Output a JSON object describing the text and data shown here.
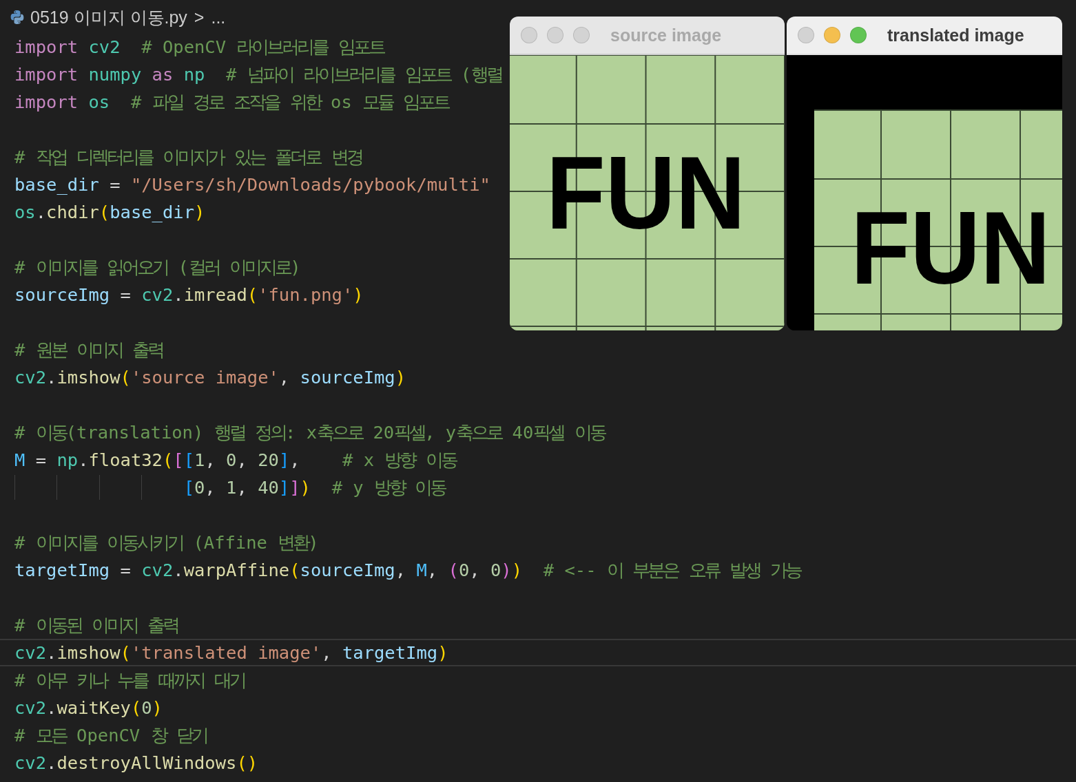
{
  "breadcrumb": {
    "file": "0519 이미지 이동.py",
    "separator": ">",
    "more": "..."
  },
  "code_lines": [
    {
      "current": false,
      "tokens": [
        {
          "text": "import",
          "kind": "kw"
        },
        {
          "text": " cv2",
          "kind": "mod"
        },
        {
          "text": "  # OpenCV 라이브러리를 임포트",
          "kind": "cm"
        }
      ]
    },
    {
      "current": false,
      "tokens": [
        {
          "text": "import",
          "kind": "kw"
        },
        {
          "text": " numpy",
          "kind": "mod"
        },
        {
          "text": " as",
          "kind": "kw"
        },
        {
          "text": " np",
          "kind": "mod"
        },
        {
          "text": "  # 넘파이 라이브러리를 임포트 (행렬",
          "kind": "cm"
        }
      ]
    },
    {
      "current": false,
      "tokens": [
        {
          "text": "import",
          "kind": "kw"
        },
        {
          "text": " os",
          "kind": "mod"
        },
        {
          "text": "  # 파일 경로 조작을 위한 os 모듈 임포트",
          "kind": "cm"
        }
      ]
    },
    {
      "current": false
    },
    {
      "current": false,
      "tokens": [
        {
          "text": "# 작업 디렉터리를 이미지가 있는 폴더로 변경",
          "kind": "cm"
        }
      ]
    },
    {
      "current": false,
      "tokens": [
        {
          "text": "base_dir",
          "kind": "var"
        },
        {
          "text": " = ",
          "kind": "p"
        },
        {
          "text": "\"/Users/sh/Downloads/pybook/multi\"",
          "kind": "str"
        }
      ]
    },
    {
      "current": false,
      "tokens": [
        {
          "text": "os",
          "kind": "mod"
        },
        {
          "text": ".",
          "kind": "p"
        },
        {
          "text": "chdir",
          "kind": "fn"
        },
        {
          "text": "(",
          "kind": "b1"
        },
        {
          "text": "base_dir",
          "kind": "var"
        },
        {
          "text": ")",
          "kind": "b1"
        }
      ]
    },
    {
      "current": false
    },
    {
      "current": false,
      "tokens": [
        {
          "text": "# 이미지를 읽어오기 (컬러 이미지로)",
          "kind": "cm"
        }
      ]
    },
    {
      "current": false,
      "tokens": [
        {
          "text": "sourceImg",
          "kind": "var"
        },
        {
          "text": " = ",
          "kind": "p"
        },
        {
          "text": "cv2",
          "kind": "mod"
        },
        {
          "text": ".",
          "kind": "p"
        },
        {
          "text": "imread",
          "kind": "fn"
        },
        {
          "text": "(",
          "kind": "b1"
        },
        {
          "text": "'fun.png'",
          "kind": "str"
        },
        {
          "text": ")",
          "kind": "b1"
        }
      ]
    },
    {
      "current": false
    },
    {
      "current": false,
      "tokens": [
        {
          "text": "# 원본 이미지 출력",
          "kind": "cm"
        }
      ]
    },
    {
      "current": false,
      "tokens": [
        {
          "text": "cv2",
          "kind": "mod"
        },
        {
          "text": ".",
          "kind": "p"
        },
        {
          "text": "imshow",
          "kind": "fn"
        },
        {
          "text": "(",
          "kind": "b1"
        },
        {
          "text": "'source image'",
          "kind": "str"
        },
        {
          "text": ",",
          "kind": "p"
        },
        {
          "text": " sourceImg",
          "kind": "var"
        },
        {
          "text": ")",
          "kind": "b1"
        }
      ]
    },
    {
      "current": false
    },
    {
      "current": false,
      "tokens": [
        {
          "text": "# 이동(translation) 행렬 정의: x축으로 20픽셀, y축으로 40픽셀 이동",
          "kind": "cm"
        }
      ]
    },
    {
      "current": false,
      "tokens": [
        {
          "text": "M",
          "kind": "const"
        },
        {
          "text": " = ",
          "kind": "p"
        },
        {
          "text": "np",
          "kind": "mod"
        },
        {
          "text": ".",
          "kind": "p"
        },
        {
          "text": "float32",
          "kind": "fn"
        },
        {
          "text": "(",
          "kind": "b1"
        },
        {
          "text": "[",
          "kind": "b2"
        },
        {
          "text": "[",
          "kind": "b3"
        },
        {
          "text": "1",
          "kind": "num"
        },
        {
          "text": ",",
          "kind": "p"
        },
        {
          "text": " 0",
          "kind": "num"
        },
        {
          "text": ",",
          "kind": "p"
        },
        {
          "text": " 20",
          "kind": "num"
        },
        {
          "text": "]",
          "kind": "b3"
        },
        {
          "text": ",",
          "kind": "p"
        },
        {
          "text": "    # x 방향 이동",
          "kind": "cm"
        }
      ]
    },
    {
      "current": false,
      "tokens": [
        {
          "text": "                [",
          "kind": "b3"
        },
        {
          "text": "0",
          "kind": "num"
        },
        {
          "text": ",",
          "kind": "p"
        },
        {
          "text": " 1",
          "kind": "num"
        },
        {
          "text": ",",
          "kind": "p"
        },
        {
          "text": " 40",
          "kind": "num"
        },
        {
          "text": "]",
          "kind": "b3"
        },
        {
          "text": "]",
          "kind": "b2"
        },
        {
          "text": ")",
          "kind": "b1"
        },
        {
          "text": "  # y 방향 이동",
          "kind": "cm"
        }
      ]
    },
    {
      "current": false
    },
    {
      "current": false,
      "tokens": [
        {
          "text": "# 이미지를 이동시키기 (Affine 변환)",
          "kind": "cm"
        }
      ]
    },
    {
      "current": false,
      "tokens": [
        {
          "text": "targetImg",
          "kind": "var"
        },
        {
          "text": " = ",
          "kind": "p"
        },
        {
          "text": "cv2",
          "kind": "mod"
        },
        {
          "text": ".",
          "kind": "p"
        },
        {
          "text": "warpAffine",
          "kind": "fn"
        },
        {
          "text": "(",
          "kind": "b1"
        },
        {
          "text": "sourceImg",
          "kind": "var"
        },
        {
          "text": ",",
          "kind": "p"
        },
        {
          "text": " M",
          "kind": "const"
        },
        {
          "text": ",",
          "kind": "p"
        },
        {
          "text": " (",
          "kind": "b2"
        },
        {
          "text": "0",
          "kind": "num"
        },
        {
          "text": ",",
          "kind": "p"
        },
        {
          "text": " 0",
          "kind": "num"
        },
        {
          "text": ")",
          "kind": "b2"
        },
        {
          "text": ")",
          "kind": "b1"
        },
        {
          "text": "  # <-- 이 부분은 오류 발생 가능",
          "kind": "cm"
        }
      ]
    },
    {
      "current": false
    },
    {
      "current": false,
      "tokens": [
        {
          "text": "# 이동된 이미지 출력",
          "kind": "cm"
        }
      ]
    },
    {
      "current": true,
      "tokens": [
        {
          "text": "cv2",
          "kind": "mod"
        },
        {
          "text": ".",
          "kind": "p"
        },
        {
          "text": "imshow",
          "kind": "fn"
        },
        {
          "text": "(",
          "kind": "b1"
        },
        {
          "text": "'translated image'",
          "kind": "str"
        },
        {
          "text": ",",
          "kind": "p"
        },
        {
          "text": " targetImg",
          "kind": "var"
        },
        {
          "text": ")",
          "kind": "b1"
        }
      ]
    },
    {
      "current": false,
      "tokens": [
        {
          "text": "# 아무 키나 누를 때까지 대기",
          "kind": "cm"
        }
      ]
    },
    {
      "current": false,
      "tokens": [
        {
          "text": "cv2",
          "kind": "mod"
        },
        {
          "text": ".",
          "kind": "p"
        },
        {
          "text": "waitKey",
          "kind": "fn"
        },
        {
          "text": "(",
          "kind": "b1"
        },
        {
          "text": "0",
          "kind": "num"
        },
        {
          "text": ")",
          "kind": "b1"
        }
      ]
    },
    {
      "current": false,
      "tokens": [
        {
          "text": "# 모든 OpenCV 창 닫기",
          "kind": "cm"
        }
      ]
    },
    {
      "current": false,
      "tokens": [
        {
          "text": "cv2",
          "kind": "mod"
        },
        {
          "text": ".",
          "kind": "p"
        },
        {
          "text": "destroyAllWindows",
          "kind": "fn"
        },
        {
          "text": "()",
          "kind": "b1"
        }
      ]
    }
  ],
  "windows": [
    {
      "title": "source image",
      "active": false,
      "kind": "source",
      "image_text": "FUN"
    },
    {
      "title": "translated image",
      "active": true,
      "kind": "translated",
      "image_text": "FUN"
    }
  ]
}
